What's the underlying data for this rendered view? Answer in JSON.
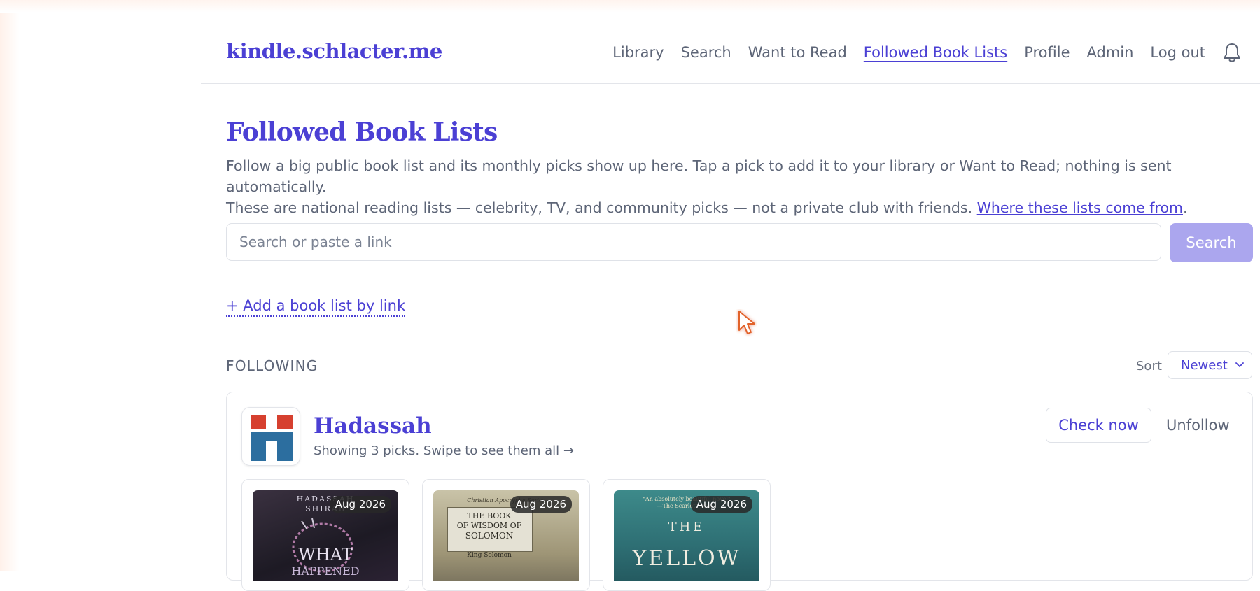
{
  "header": {
    "brand": "kindle.schlacter.me",
    "nav": [
      {
        "label": "Library"
      },
      {
        "label": "Search"
      },
      {
        "label": "Want to Read"
      },
      {
        "label": "Followed Book Lists",
        "active": true
      },
      {
        "label": "Profile"
      },
      {
        "label": "Admin"
      },
      {
        "label": "Log out"
      }
    ],
    "bell_icon": "bell-icon"
  },
  "page": {
    "title": "Followed Book Lists",
    "intro_line1": "Follow a big public book list and its monthly picks show up here. Tap a pick to add it to your library or Want to Read; nothing is sent automatically.",
    "intro_line2": "These are national reading lists — celebrity, TV, and community picks — not a private club with friends.",
    "intro_link": "Where these lists come from",
    "intro_end": "."
  },
  "search": {
    "placeholder": "Search or paste a link",
    "value": "",
    "button_label": "Search"
  },
  "add_link": "+ Add a book list by link",
  "following": {
    "section_label": "FOLLOWING",
    "sort_label": "Sort",
    "sort_value": "Newest"
  },
  "lists": [
    {
      "name": "Hadassah",
      "subtitle": "Showing 3 picks. Swipe to see them all →",
      "check_label": "Check now",
      "unfollow_label": "Unfollow",
      "picks": [
        {
          "badge": "Aug 2026",
          "cover_text": [
            "HADASSAH",
            "SHIRAB",
            "WHAT",
            "HAPPENED"
          ]
        },
        {
          "badge": "Aug 2026",
          "cover_text": [
            "Christian Apocrypha Series",
            "THE BOOK",
            "OF WISDOM OF",
            "SOLOMON",
            "King Solomon"
          ]
        },
        {
          "badge": "Aug 2026",
          "cover_text": [
            "\"An absolutely beautiful novel\"",
            "—The Scarlett Times",
            "THE",
            "YELLOW"
          ]
        }
      ]
    }
  ],
  "colors": {
    "accent": "#4b40d4",
    "muted_text": "#5d6577",
    "search_button": "#aba6ee",
    "border": "#e3e5ea"
  }
}
